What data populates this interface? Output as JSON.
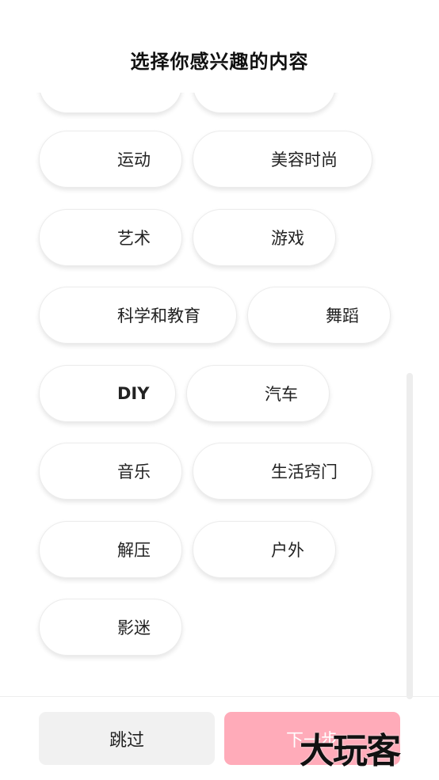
{
  "header": {
    "title": "选择你感兴趣的内容"
  },
  "interests": [
    {
      "label": ""
    },
    {
      "label": ""
    },
    {
      "label": "运动"
    },
    {
      "label": "美容时尚"
    },
    {
      "label": "艺术"
    },
    {
      "label": "游戏"
    },
    {
      "label": "科学和教育"
    },
    {
      "label": "舞蹈"
    },
    {
      "label": "DIY"
    },
    {
      "label": "汽车"
    },
    {
      "label": "音乐"
    },
    {
      "label": "生活窍门"
    },
    {
      "label": "解压"
    },
    {
      "label": "户外"
    },
    {
      "label": "影迷"
    }
  ],
  "footer": {
    "skip_label": "跳过",
    "next_label": "下一步"
  },
  "watermark": {
    "text": "大玩客"
  }
}
